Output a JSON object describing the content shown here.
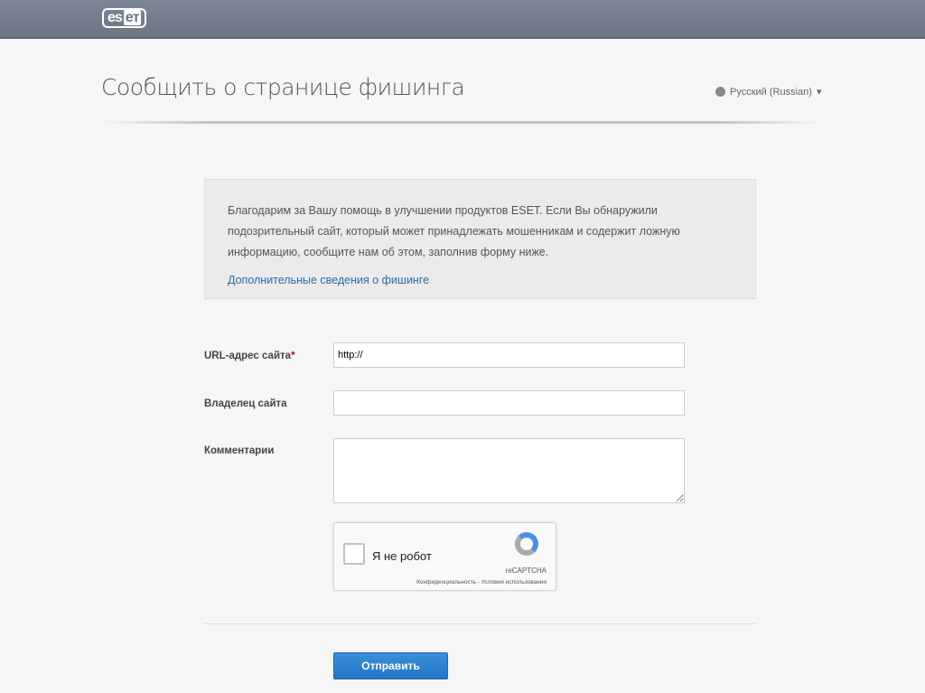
{
  "header": {
    "logo": "ESET"
  },
  "page": {
    "title": "Сообщить о странице фишинга",
    "language": "Русский (Russian)"
  },
  "info": {
    "text": "Благодарим за Вашу помощь в улучшении продуктов ESET. Если Вы обнаружили подозрительный сайт, который может принадлежать мошенникам и содержит ложную информацию, сообщите нам об этом, заполнив форму ниже.",
    "link": "Дополнительные сведения о фишинге"
  },
  "form": {
    "url_label": "URL-адрес сайта",
    "required_mark": "*",
    "url_value": "http://",
    "owner_label": "Владелец сайта",
    "owner_value": "",
    "comments_label": "Комментарии",
    "comments_value": "",
    "submit": "Отправить"
  },
  "captcha": {
    "label": "Я не робот",
    "brand": "reCAPTCHA",
    "links": "Конфиденциальность - Условия использования"
  }
}
